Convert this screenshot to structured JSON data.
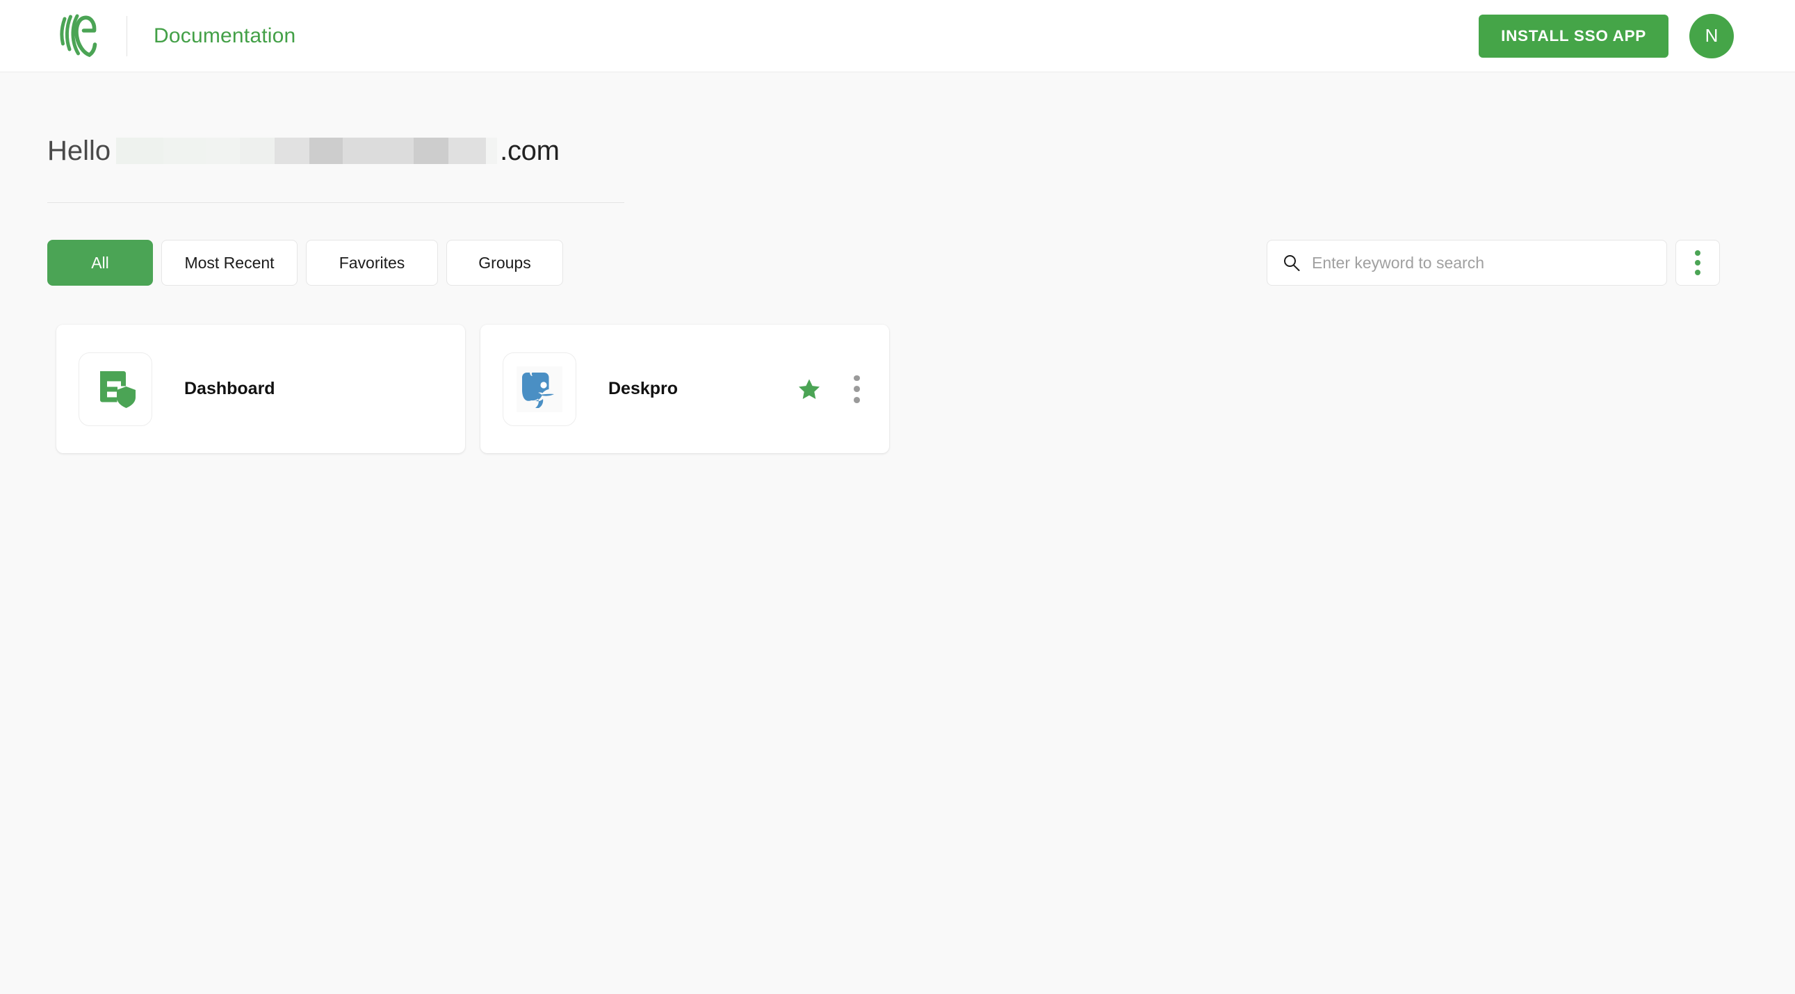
{
  "header": {
    "logo_icon": "evernote-style-logo-icon",
    "brand_title": "Documentation",
    "install_button_label": "INSTALL SSO APP",
    "avatar_initial": "N",
    "accent_color": "#45a548"
  },
  "greeting": {
    "hello_label": "Hello",
    "redacted_name": "",
    "domain_suffix": ".com"
  },
  "toolbar": {
    "tabs": [
      {
        "label": "All",
        "active": true
      },
      {
        "label": "Most Recent",
        "active": false
      },
      {
        "label": "Favorites",
        "active": false
      },
      {
        "label": "Groups",
        "active": false
      }
    ],
    "search": {
      "placeholder": "Enter keyword to search",
      "value": "",
      "icon": "search-icon"
    },
    "overflow_menu_icon": "vertical-dots-icon"
  },
  "apps": [
    {
      "name": "Dashboard",
      "icon": "dashboard-shield-icon",
      "icon_color": "#4ba455",
      "favorited": false,
      "has_menu": false
    },
    {
      "name": "Deskpro",
      "icon": "deskpro-elephant-icon",
      "icon_color": "#4a8fc4",
      "favorited": true,
      "has_menu": true,
      "star_color": "#4ba455",
      "menu_icon": "vertical-dots-icon"
    }
  ]
}
